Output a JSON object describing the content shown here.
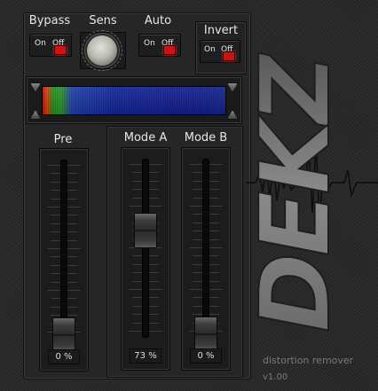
{
  "controls": {
    "bypass": {
      "label": "Bypass",
      "on": "On",
      "off": "Off",
      "state": "Off"
    },
    "sens": {
      "label": "Sens"
    },
    "auto": {
      "label": "Auto",
      "on": "On",
      "off": "Off",
      "state": "Off"
    },
    "invert": {
      "label": "Invert",
      "on": "On",
      "off": "Off",
      "state": "Off"
    }
  },
  "faders": {
    "pre": {
      "label": "Pre",
      "value": "0 %",
      "level": 0.0
    },
    "mode_a": {
      "label": "Mode A",
      "value": "73 %",
      "level": 0.73
    },
    "mode_b": {
      "label": "Mode B",
      "value": "0 %",
      "level": 0.0
    }
  },
  "branding": {
    "product": "distortion remover",
    "version": "v1.00",
    "logo_text": "DEKZ"
  },
  "colors": {
    "led_red": "#c81414",
    "meter_blue": "#1326a6",
    "meter_red": "#d01010",
    "meter_green": "#19a619"
  },
  "icons": [
    "knob-icon",
    "led-indicator-icon",
    "range-handle-icon"
  ]
}
